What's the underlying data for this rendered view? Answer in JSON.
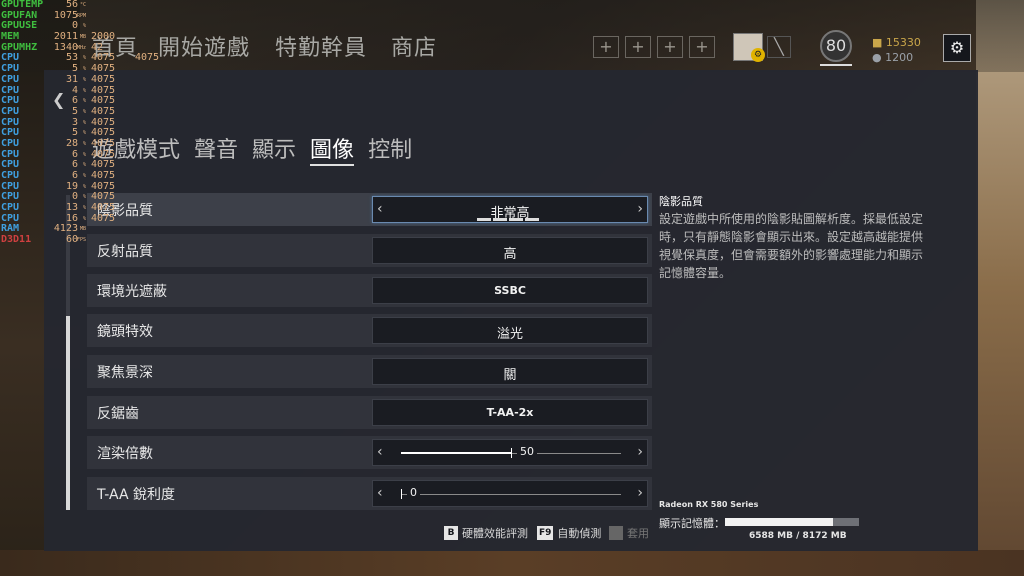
{
  "nav": {
    "items": [
      "首頁",
      "開始遊戲",
      "特勤幹員",
      "商店"
    ],
    "level": "80",
    "renown": "15330",
    "credits": "1200",
    "plus_slots": [
      "+",
      "+",
      "+",
      "+"
    ]
  },
  "tabs": [
    "遊戲模式",
    "聲音",
    "顯示",
    "圖像",
    "控制"
  ],
  "active_tab": "圖像",
  "settings": [
    {
      "label": "陰影品質",
      "value": "非常高",
      "type": "select",
      "steps": 4,
      "active": true
    },
    {
      "label": "反射品質",
      "value": "高",
      "type": "select"
    },
    {
      "label": "環境光遮蔽",
      "value": "SSBC",
      "type": "select"
    },
    {
      "label": "鏡頭特效",
      "value": "溢光",
      "type": "select"
    },
    {
      "label": "聚焦景深",
      "value": "關",
      "type": "select"
    },
    {
      "label": "反鋸齒",
      "value": "T-AA-2x",
      "type": "select"
    },
    {
      "label": "渲染倍數",
      "value": "50",
      "type": "slider",
      "fraction": 0.5
    },
    {
      "label": "T-AA 銳利度",
      "value": "0",
      "type": "slider",
      "fraction": 0.0
    }
  ],
  "description": {
    "title": "陰影品質",
    "body": "設定遊戲中所使用的陰影貼圖解析度。採最低設定時，只有靜態陰影會顯示出來。設定越高越能提供視覺保真度，但會需要額外的影響處理能力和顯示記憶體容量。"
  },
  "gpu": {
    "name": "Radeon RX 580 Series",
    "vram_label": "顯示記憶體：",
    "vram_text": "6588 MB / 8172 MB",
    "vram_fraction": 0.806
  },
  "footer": [
    {
      "key": "B",
      "label": "硬體效能評測",
      "disabled": false
    },
    {
      "key": "F9",
      "label": "自動偵測",
      "disabled": false
    },
    {
      "key": "",
      "label": "套用",
      "disabled": true
    }
  ],
  "osd": [
    {
      "label": "GPUTEMP",
      "value": "56",
      "unit": "°C",
      "color": "#3fbf3f"
    },
    {
      "label": "GPUFAN",
      "value": "1075",
      "unit": "RPM",
      "color": "#3fbf3f"
    },
    {
      "label": "GPUUSE",
      "value": "0",
      "unit": "%",
      "color": "#3fbf3f"
    },
    {
      "label": "MEM",
      "value": "2011",
      "unit": "MB",
      "color": "#3fbf3f"
    },
    {
      "label": "GPUMHZ",
      "value": "1340",
      "unit": "MHz",
      "color": "#3fbf3f"
    },
    {
      "label": "CPU",
      "value": "53",
      "unit": "%",
      "color": "#3f9fdf"
    },
    {
      "label": "CPU",
      "value": "5",
      "unit": "%",
      "color": "#3f9fdf"
    },
    {
      "label": "CPU",
      "value": "31",
      "unit": "%",
      "color": "#3f9fdf"
    },
    {
      "label": "CPU",
      "value": "4",
      "unit": "%",
      "color": "#3f9fdf"
    },
    {
      "label": "CPU",
      "value": "6",
      "unit": "%",
      "color": "#3f9fdf"
    },
    {
      "label": "CPU",
      "value": "5",
      "unit": "%",
      "color": "#3f9fdf"
    },
    {
      "label": "CPU",
      "value": "3",
      "unit": "%",
      "color": "#3f9fdf"
    },
    {
      "label": "CPU",
      "value": "5",
      "unit": "%",
      "color": "#3f9fdf"
    },
    {
      "label": "CPU",
      "value": "28",
      "unit": "%",
      "color": "#3f9fdf"
    },
    {
      "label": "CPU",
      "value": "6",
      "unit": "%",
      "color": "#3f9fdf"
    },
    {
      "label": "CPU",
      "value": "6",
      "unit": "%",
      "color": "#3f9fdf"
    },
    {
      "label": "CPU",
      "value": "6",
      "unit": "%",
      "color": "#3f9fdf"
    },
    {
      "label": "CPU",
      "value": "19",
      "unit": "%",
      "color": "#3f9fdf"
    },
    {
      "label": "CPU",
      "value": "0",
      "unit": "%",
      "color": "#3f9fdf"
    },
    {
      "label": "CPU",
      "value": "13",
      "unit": "%",
      "color": "#3f9fdf"
    },
    {
      "label": "CPU",
      "value": "16",
      "unit": "%",
      "color": "#3f9fdf"
    },
    {
      "label": "RAM",
      "value": "4123",
      "unit": "MB",
      "color": "#3f9fdf"
    },
    {
      "label": "D3D11",
      "value": "60",
      "unit": "FPS",
      "color": "#d04040"
    }
  ],
  "osd_mid": [
    "2000",
    "42",
    "4075",
    "4075",
    "4075",
    "4075",
    "4075",
    "4075",
    "4075",
    "4075",
    "4075",
    "4075",
    "4075",
    "4075",
    "4075",
    "4075",
    "4075",
    "4075"
  ],
  "osd_extra": "4075"
}
